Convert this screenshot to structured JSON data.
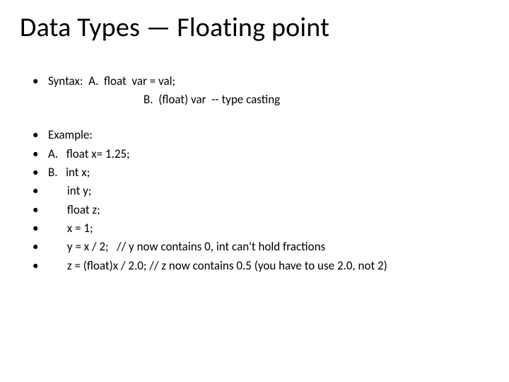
{
  "title": "Data Types — Floating point",
  "syntax": {
    "line": "Syntax:  A.  float  var = val;",
    "sub": "B.  (float) var  -- type casting"
  },
  "example": {
    "head": "Example:",
    "a": "A.   float x= 1.25;",
    "b": "B.   int x;",
    "l1": "       int y;",
    "l2": "       float z;",
    "l3": "       x = 1;",
    "l4": "       y = x / 2;   // y now contains 0, int can't hold fractions",
    "l5": "       z = (float)x / 2.0; // z now contains 0.5 (you have to use 2.0, not 2)"
  }
}
